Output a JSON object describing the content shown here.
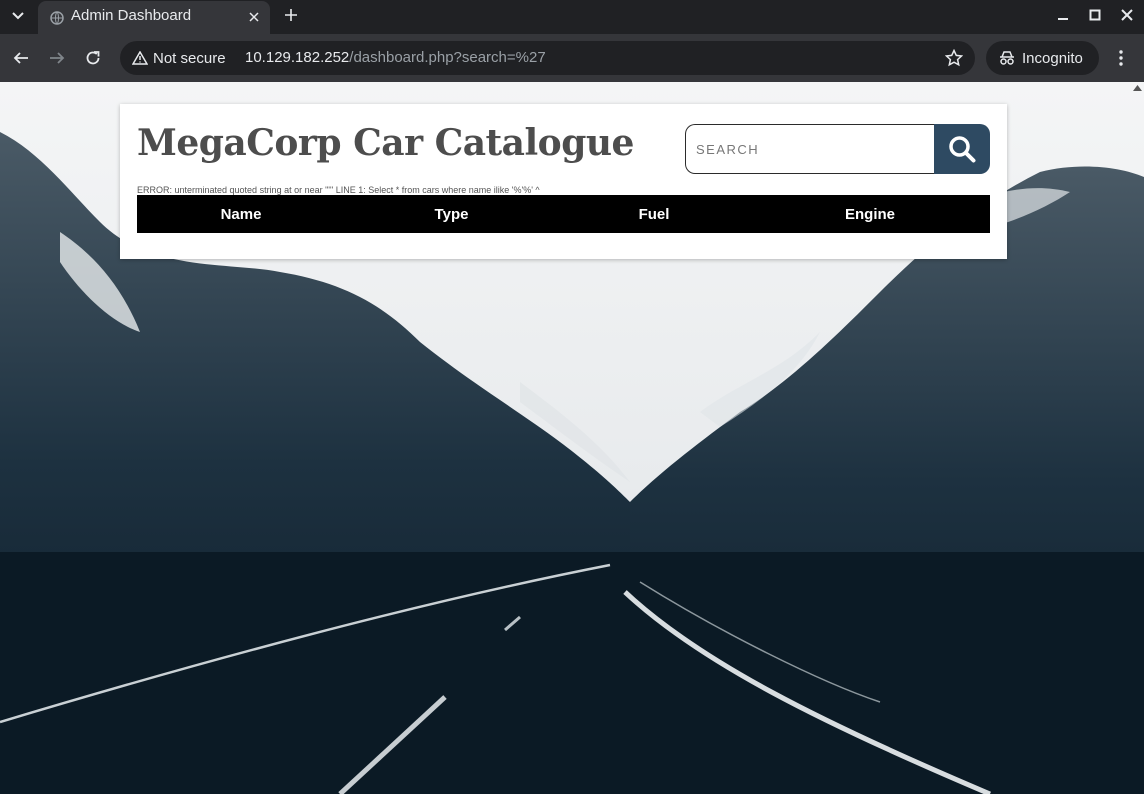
{
  "browser": {
    "tab_title": "Admin Dashboard",
    "security_label": "Not secure",
    "url_host": "10.129.182.252",
    "url_path": "/dashboard.php?search=%27",
    "profile_label": "Incognito"
  },
  "page": {
    "title": "MegaCorp Car Catalogue",
    "search": {
      "placeholder": "SEARCH",
      "value": ""
    },
    "error_message": "ERROR: unterminated quoted string at or near \"'\" LINE 1: Select * from cars where name ilike '%'%' ^",
    "table": {
      "columns": [
        "Name",
        "Type",
        "Fuel",
        "Engine"
      ],
      "rows": []
    }
  },
  "colors": {
    "search_button": "#2e4a62",
    "table_header": "#000000",
    "title_text": "#4d4d4d"
  }
}
